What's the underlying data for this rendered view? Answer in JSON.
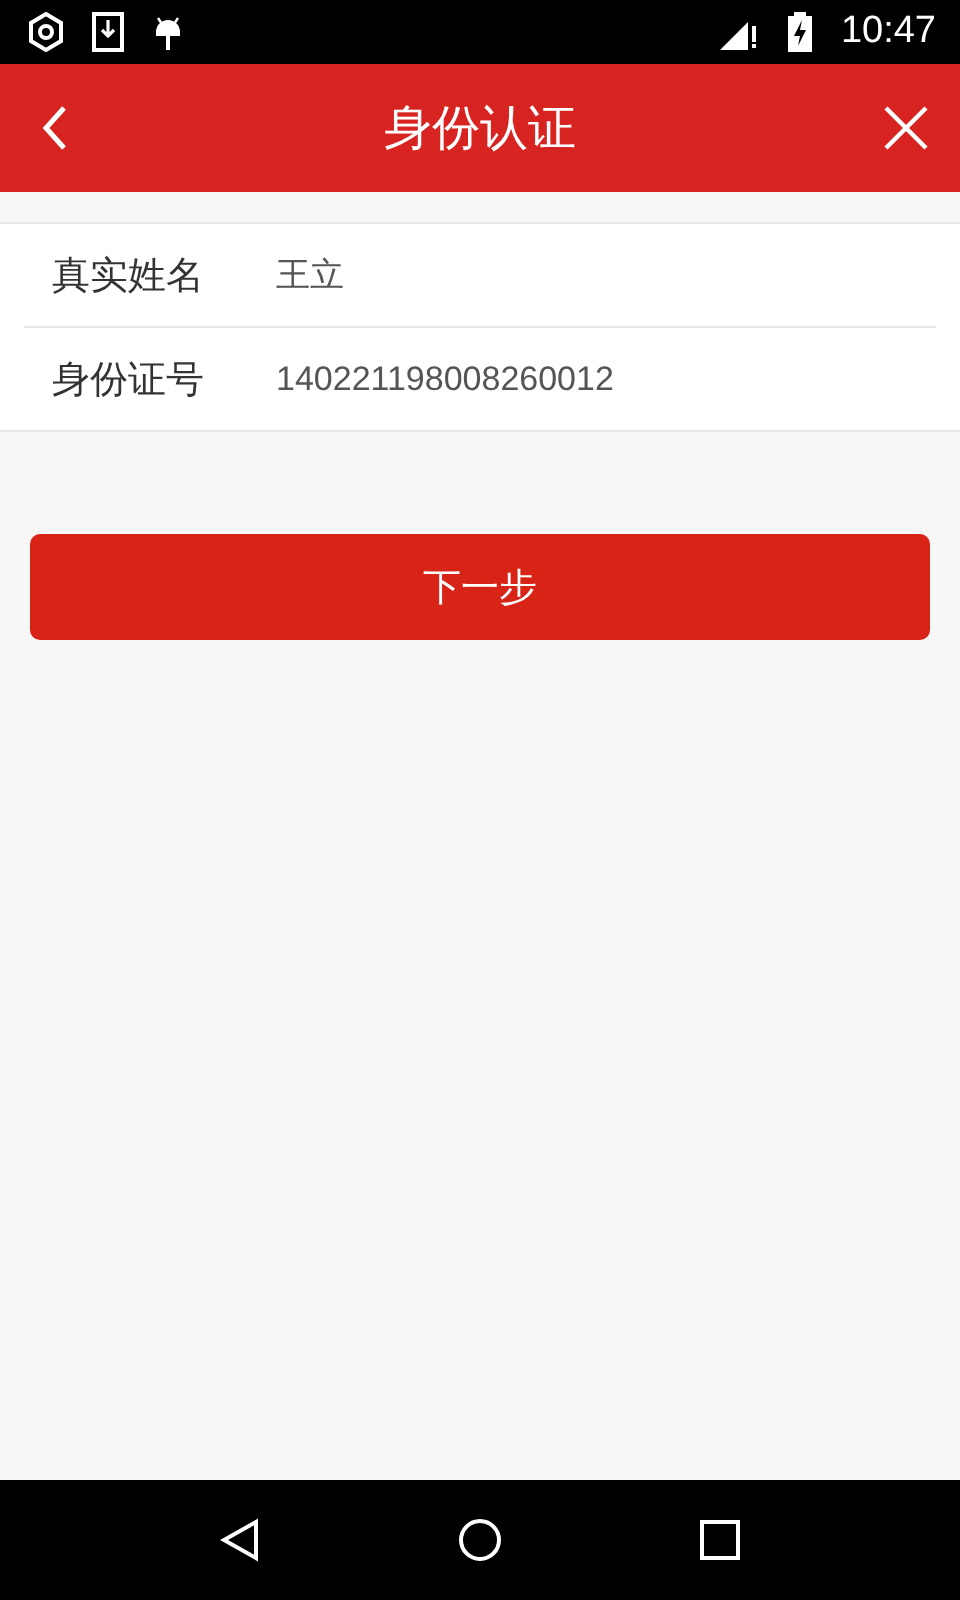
{
  "status_bar": {
    "time": "10:47"
  },
  "header": {
    "title": "身份认证"
  },
  "form": {
    "rows": [
      {
        "label": "真实姓名",
        "value": "王立"
      },
      {
        "label": "身份证号",
        "value": "140221198008260012"
      }
    ]
  },
  "next_button": {
    "label": "下一步"
  }
}
